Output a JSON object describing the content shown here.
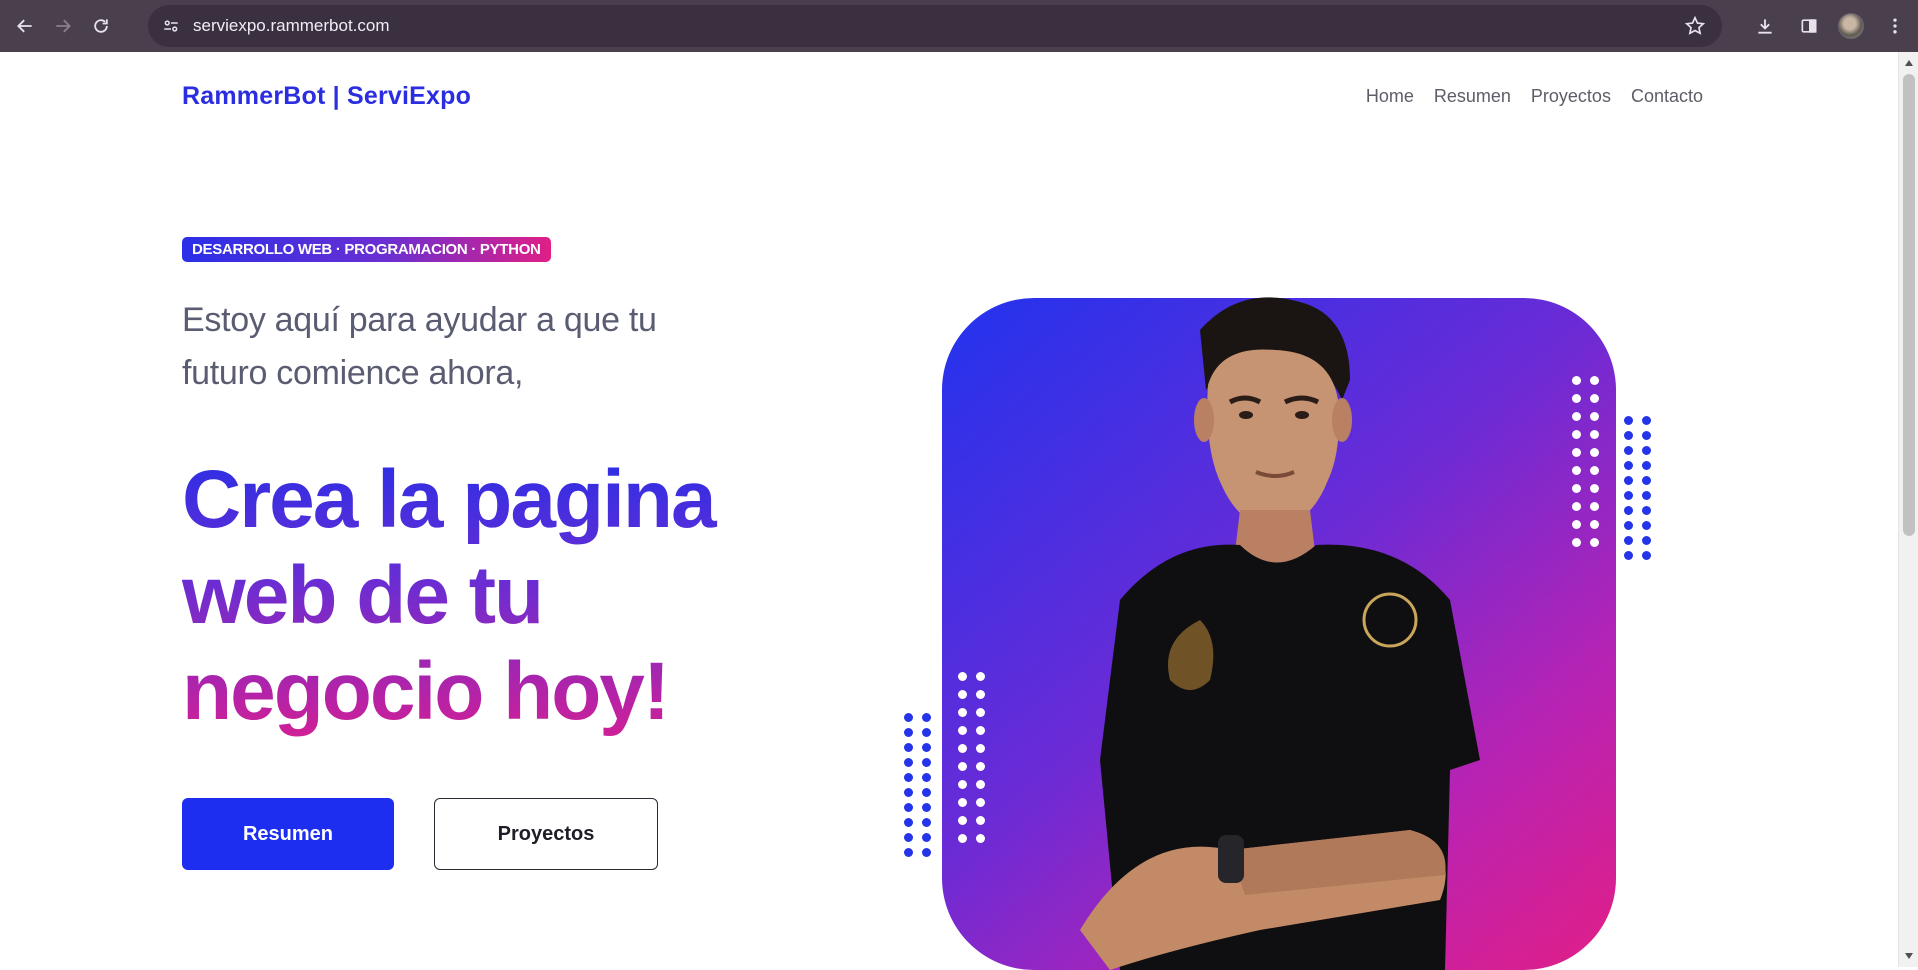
{
  "browser": {
    "url": "serviexpo.rammerbot.com"
  },
  "site": {
    "brand": "RammerBot | ServiExpo",
    "nav": [
      {
        "label": "Home"
      },
      {
        "label": "Resumen"
      },
      {
        "label": "Proyectos"
      },
      {
        "label": "Contacto"
      }
    ]
  },
  "hero": {
    "badge": "DESARROLLO WEB · PROGRAMACION · PYTHON",
    "lead": "Estoy aquí para ayudar a que tu futuro comience ahora,",
    "headline": "Crea la pagina web de tu negocio hoy!",
    "primary_button": "Resumen",
    "secondary_button": "Proyectos"
  },
  "colors": {
    "brand_blue": "#2b2ee0",
    "button_blue": "#1d2ef0",
    "gradient_magenta": "#e21e86",
    "chrome_bg": "#4a3f4d"
  }
}
